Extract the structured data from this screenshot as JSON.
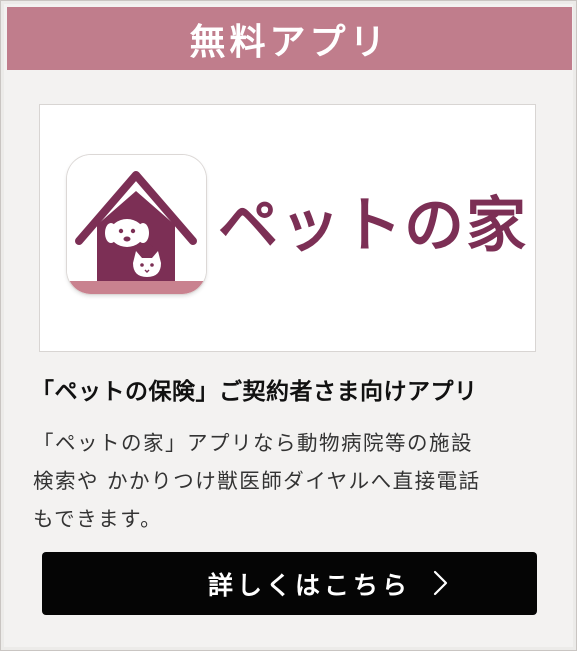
{
  "header": {
    "title": "無料アプリ"
  },
  "banner": {
    "app_name": "ペットの家",
    "icon": "pet-house-dog-cat-icon"
  },
  "section": {
    "subtitle": "「ペットの保険」ご契約者さま向けアプリ",
    "description_lines": [
      "「ペットの家」アプリなら動物病院等の施設",
      "検索や かかりつけ獣医師ダイヤルへ直接電話",
      "もできます。"
    ]
  },
  "cta": {
    "label": "詳しくはこちら",
    "icon": "chevron-right-icon"
  },
  "colors": {
    "header_bg": "#c07d8c",
    "brand": "#7c2f55",
    "button_bg": "#050505"
  }
}
